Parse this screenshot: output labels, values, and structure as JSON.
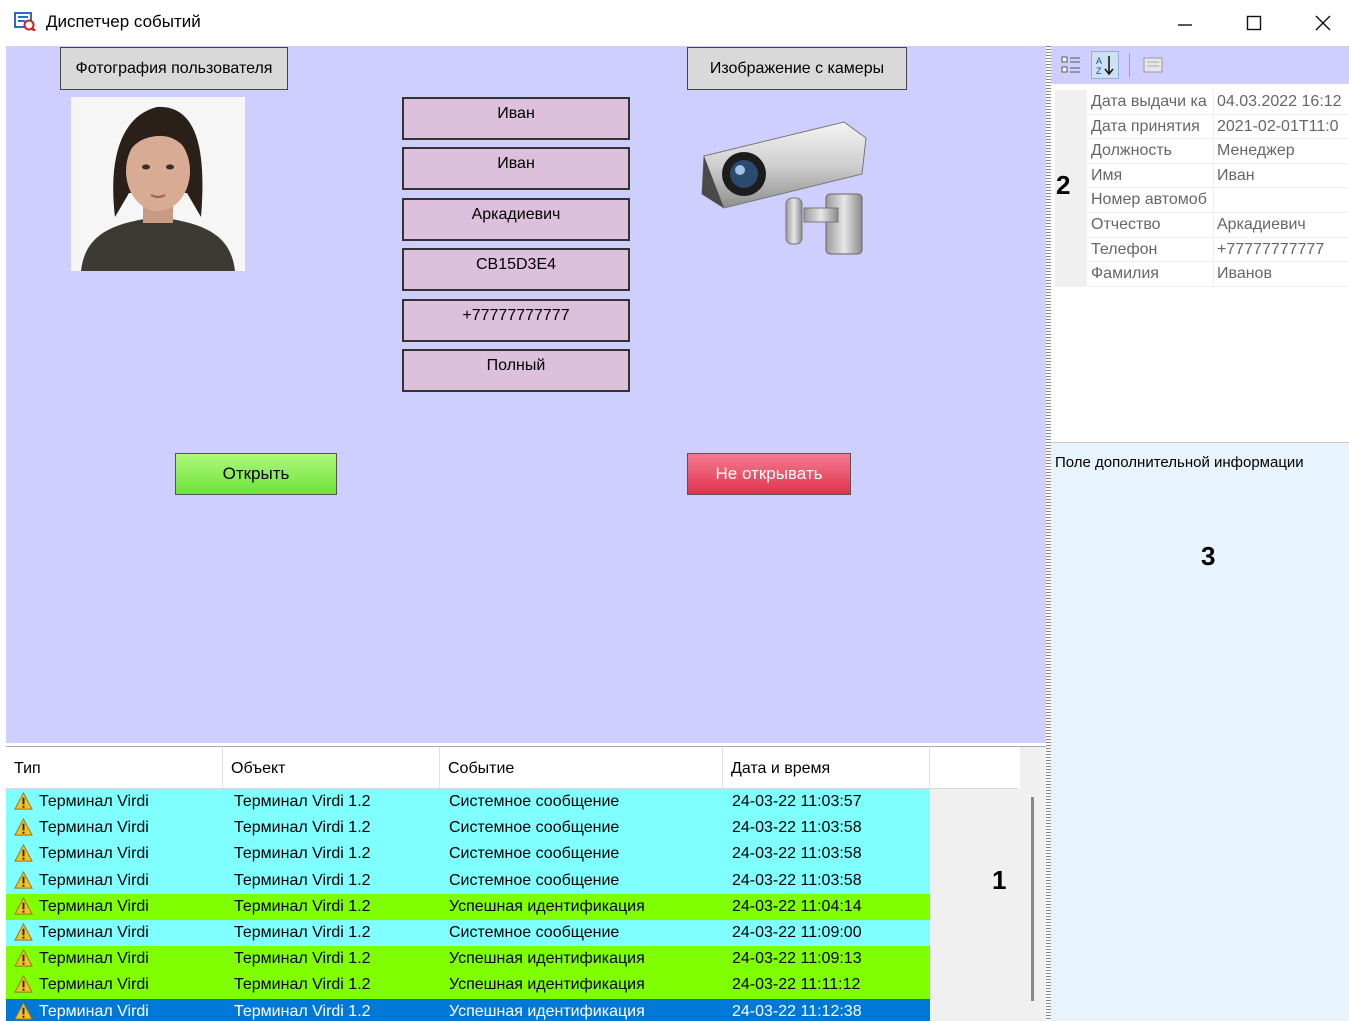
{
  "window": {
    "title": "Диспетчер событий",
    "icon": "event-dispatcher-icon"
  },
  "form": {
    "photo_label": "Фотография пользователя",
    "camera_label": "Изображение с камеры",
    "fields": [
      "Иван",
      "Иван",
      "Аркадиевич",
      "CB15D3E4",
      "+77777777777",
      "Полный"
    ],
    "open_button": "Открыть",
    "deny_button": "Не открывать"
  },
  "table": {
    "columns": [
      "Тип",
      "Объект",
      "Событие",
      "Дата и время"
    ],
    "rows": [
      {
        "type": "Терминал Virdi",
        "object": "Терминал Virdi 1.2",
        "event": "Системное сообщение",
        "datetime": "24-03-22 11:03:57",
        "status": "system"
      },
      {
        "type": "Терминал Virdi",
        "object": "Терминал Virdi 1.2",
        "event": "Системное сообщение",
        "datetime": "24-03-22 11:03:58",
        "status": "system"
      },
      {
        "type": "Терминал Virdi",
        "object": "Терминал Virdi 1.2",
        "event": "Системное сообщение",
        "datetime": "24-03-22 11:03:58",
        "status": "system"
      },
      {
        "type": "Терминал Virdi",
        "object": "Терминал Virdi 1.2",
        "event": "Системное сообщение",
        "datetime": "24-03-22 11:03:58",
        "status": "system"
      },
      {
        "type": "Терминал Virdi",
        "object": "Терминал Virdi 1.2",
        "event": "Успешная идентификация",
        "datetime": "24-03-22 11:04:14",
        "status": "success"
      },
      {
        "type": "Терминал Virdi",
        "object": "Терминал Virdi 1.2",
        "event": "Системное сообщение",
        "datetime": "24-03-22 11:09:00",
        "status": "system"
      },
      {
        "type": "Терминал Virdi",
        "object": "Терминал Virdi 1.2",
        "event": "Успешная идентификация",
        "datetime": "24-03-22 11:09:13",
        "status": "success"
      },
      {
        "type": "Терминал Virdi",
        "object": "Терминал Virdi 1.2",
        "event": "Успешная идентификация",
        "datetime": "24-03-22 11:11:12",
        "status": "success"
      },
      {
        "type": "Терминал Virdi",
        "object": "Терминал Virdi 1.2",
        "event": "Успешная идентификация",
        "datetime": "24-03-22 11:12:38",
        "status": "selected"
      }
    ],
    "row_colors": {
      "system": "#80ffff",
      "success": "#80ff00",
      "selected": "#0078d7"
    }
  },
  "properties": {
    "rows": [
      {
        "name": "Дата выдачи ка",
        "value": "04.03.2022 16:12"
      },
      {
        "name": "Дата принятия",
        "value": "2021-02-01T11:0"
      },
      {
        "name": "Должность",
        "value": "Менеджер"
      },
      {
        "name": "Имя",
        "value": "Иван"
      },
      {
        "name": "Номер автомоб",
        "value": ""
      },
      {
        "name": "Отчество",
        "value": "Аркадиевич"
      },
      {
        "name": "Телефон",
        "value": "+77777777777"
      },
      {
        "name": "Фамилия",
        "value": "Иванов"
      }
    ]
  },
  "info": {
    "label": "Поле дополнительной информации"
  },
  "annotations": {
    "n1": "1",
    "n2": "2",
    "n3": "3"
  }
}
